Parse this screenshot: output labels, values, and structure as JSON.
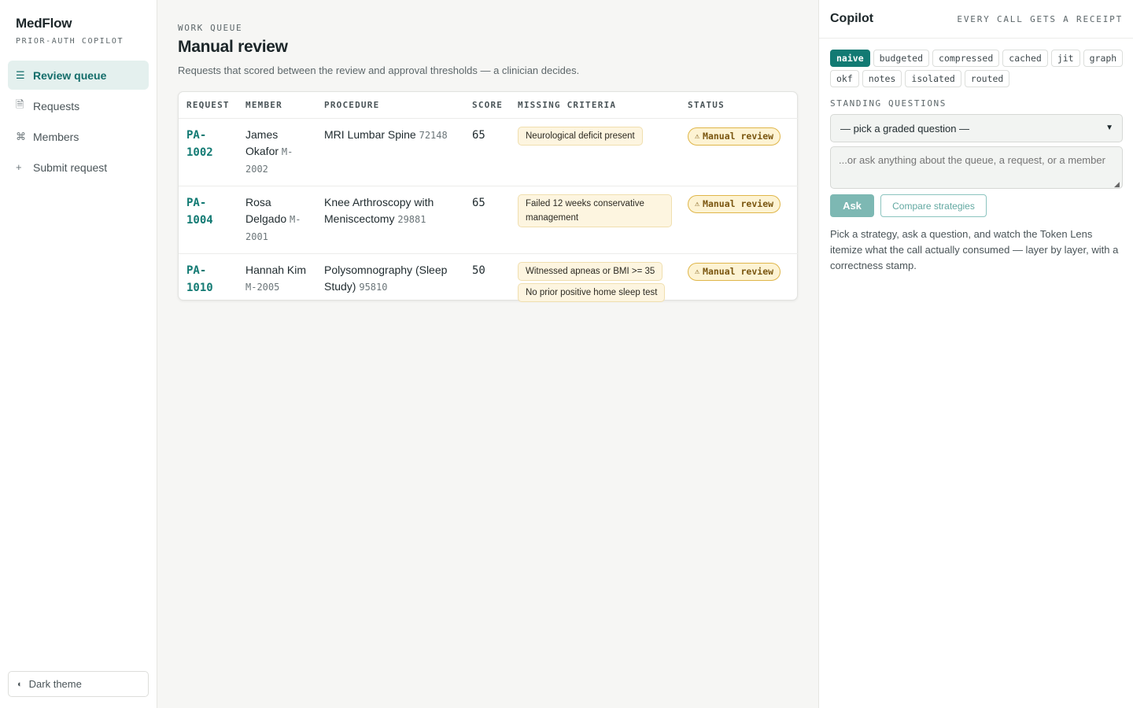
{
  "sidebar": {
    "brand": "MedFlow",
    "subtitle": "PRIOR-AUTH COPILOT",
    "nav": [
      {
        "label": "Review queue",
        "icon": "list-icon",
        "glyph": "☰",
        "active": true
      },
      {
        "label": "Requests",
        "icon": "document-icon",
        "glyph": "🗎",
        "active": false
      },
      {
        "label": "Members",
        "icon": "command-icon",
        "glyph": "⌘",
        "active": false
      },
      {
        "label": "Submit request",
        "icon": "plus-icon",
        "glyph": "+",
        "active": false
      }
    ],
    "theme_toggle": {
      "label": "Dark theme",
      "glyph": "◐"
    }
  },
  "main": {
    "eyebrow": "WORK QUEUE",
    "title": "Manual review",
    "description": "Requests that scored between the review and approval thresholds — a clinician decides.",
    "table": {
      "columns": [
        "REQUEST",
        "MEMBER",
        "PROCEDURE",
        "SCORE",
        "MISSING CRITERIA",
        "STATUS"
      ],
      "rows": [
        {
          "request_id": "PA-1002",
          "member_name": "James Okafor",
          "member_id": "M-2002",
          "procedure": "MRI Lumbar Spine",
          "code": "72148",
          "score": "65",
          "missing": [
            "Neurological deficit present"
          ],
          "status": "Manual review"
        },
        {
          "request_id": "PA-1004",
          "member_name": "Rosa Delgado",
          "member_id": "M-2001",
          "procedure": "Knee Arthroscopy with Meniscectomy",
          "code": "29881",
          "score": "65",
          "missing": [
            "Failed 12 weeks conservative management"
          ],
          "status": "Manual review"
        },
        {
          "request_id": "PA-1010",
          "member_name": "Hannah Kim",
          "member_id": "M-2005",
          "procedure": "Polysomnography (Sleep Study)",
          "code": "95810",
          "score": "50",
          "missing": [
            "Witnessed apneas or BMI >= 35",
            "No prior positive home sleep test"
          ],
          "status": "Manual review"
        }
      ]
    }
  },
  "copilot": {
    "title": "Copilot",
    "tagline": "EVERY CALL GETS A RECEIPT",
    "strategies": [
      "naive",
      "budgeted",
      "compressed",
      "cached",
      "jit",
      "graph",
      "okf",
      "notes",
      "isolated",
      "routed"
    ],
    "active_strategy": "naive",
    "standing_label": "STANDING QUESTIONS",
    "select_value": "— pick a graded question —",
    "ask_placeholder": "...or ask anything about the queue, a request, or a member",
    "ask_label": "Ask",
    "compare_label": "Compare strategies",
    "help": "Pick a strategy, ask a question, and watch the Token Lens itemize what the call actually consumed — layer by layer, with a correctness stamp.",
    "colors": {
      "accent": "#127a73",
      "warn_bg": "#fdf3d3",
      "warn_border": "#dfb64a"
    }
  }
}
